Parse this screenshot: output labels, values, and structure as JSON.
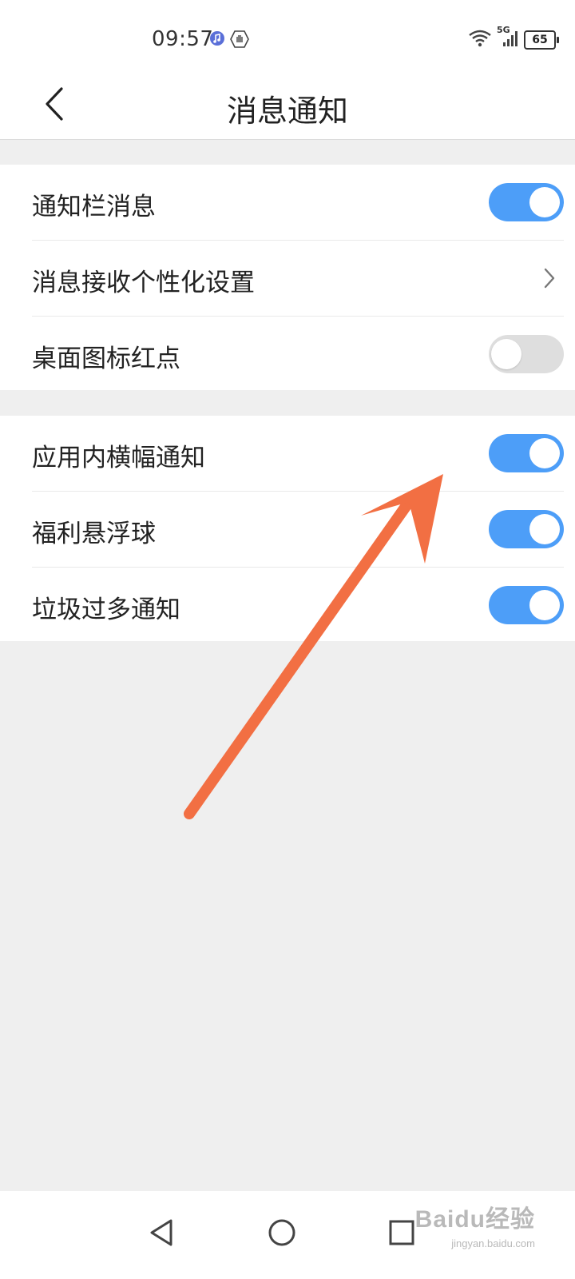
{
  "status_bar": {
    "time": "09:57",
    "left_icons": [
      "music-notification-icon",
      "hand-notification-icon"
    ],
    "network_label": "5G",
    "battery_level": "65"
  },
  "header": {
    "title": "消息通知",
    "back_icon": "chevron-left-icon"
  },
  "settings": {
    "group1": [
      {
        "label": "通知栏消息",
        "control": "toggle",
        "on": true
      },
      {
        "label": "消息接收个性化设置",
        "control": "chevron"
      },
      {
        "label": "桌面图标红点",
        "control": "toggle",
        "on": false
      }
    ],
    "group2": [
      {
        "label": "应用内横幅通知",
        "control": "toggle",
        "on": true
      },
      {
        "label": "福利悬浮球",
        "control": "toggle",
        "on": true
      },
      {
        "label": "垃圾过多通知",
        "control": "toggle",
        "on": true
      }
    ]
  },
  "annotation": {
    "arrow_color": "#f26f43",
    "points_to": "应用内横幅通知"
  },
  "colors": {
    "toggle_on": "#4d9ef8",
    "toggle_off": "#dedede",
    "background": "#efefef"
  },
  "nav_bar": {
    "buttons": [
      "back-triangle-icon",
      "home-circle-icon",
      "recents-square-icon"
    ]
  },
  "watermark": {
    "logo": "Baidu经验",
    "sub": "jingyan.baidu.com"
  }
}
